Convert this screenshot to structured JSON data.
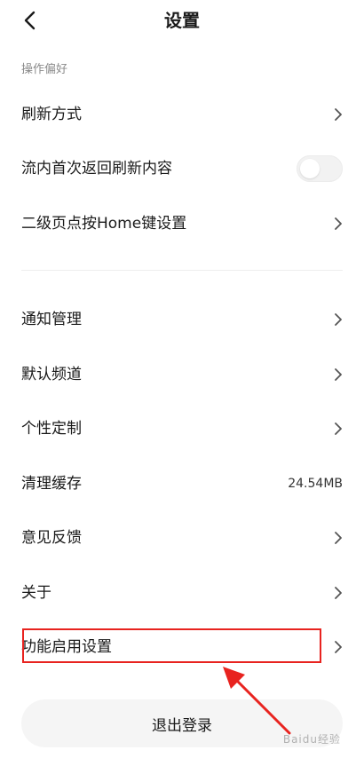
{
  "header": {
    "title": "设置",
    "back_icon": "chevron-left-icon"
  },
  "sections": {
    "preferences_label": "操作偏好"
  },
  "rows": {
    "refresh_method": "刷新方式",
    "feed_refresh": "流内首次返回刷新内容",
    "home_key": "二级页点按Home键设置",
    "notifications": "通知管理",
    "default_channel": "默认频道",
    "personalization": "个性定制",
    "clear_cache": "清理缓存",
    "cache_size": "24.54MB",
    "feedback": "意见反馈",
    "about": "关于",
    "feature_settings": "功能启用设置"
  },
  "toggles": {
    "feed_refresh_on": false
  },
  "logout": {
    "label": "退出登录"
  },
  "annotation": {
    "highlight_color": "#e8231f"
  },
  "watermark": {
    "text": "Baidu经验"
  }
}
